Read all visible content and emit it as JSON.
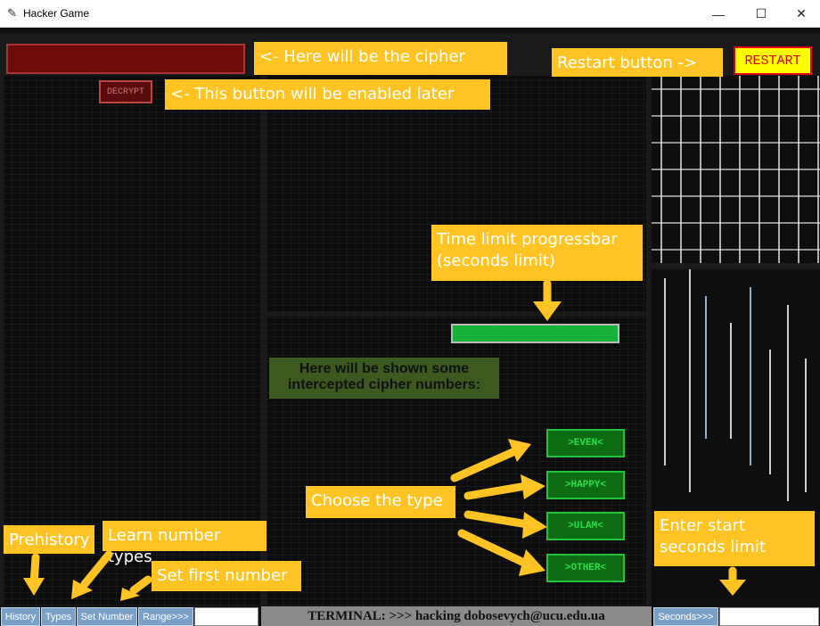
{
  "window": {
    "title": "Hacker Game",
    "app_icon": "feather-icon",
    "minimize": "—",
    "maximize": "☐",
    "close": "✕"
  },
  "controls": {
    "decrypt_label": "DECRYPT",
    "restart_label": "RESTART",
    "progress_fraction": 1.0,
    "intercept_text": "Here will be shown some intercepted cipher numbers:",
    "type_buttons": [
      ">EVEN<",
      ">HAPPY<",
      ">ULAM<",
      ">OTHER<"
    ]
  },
  "bottom_bar": {
    "buttons": [
      "History",
      "Types",
      "Set Number",
      "Range>>>"
    ],
    "terminal_text": "TERMINAL: >>> hacking dobosevych@ucu.edu.ua",
    "seconds_label": "Seconds>>>",
    "range_value": "",
    "seconds_value": ""
  },
  "annotations": {
    "cipher": "<- Here will be the cipher",
    "decrypt": "<- This button will be enabled later",
    "restart": "Restart button ->",
    "progressbar": "Time limit progressbar (seconds limit)",
    "choose": "Choose the type",
    "seconds": "Enter start seconds limit",
    "prehistory": "Prehistory",
    "learn": "Learn number types",
    "set_first": "Set first number"
  },
  "colors": {
    "accent_yellow": "#ffc423",
    "cipher_red": "#6d0a0a",
    "type_green": "#0d6b14",
    "progress_green": "#18b23a",
    "tool_blue": "#7aa0c8"
  }
}
